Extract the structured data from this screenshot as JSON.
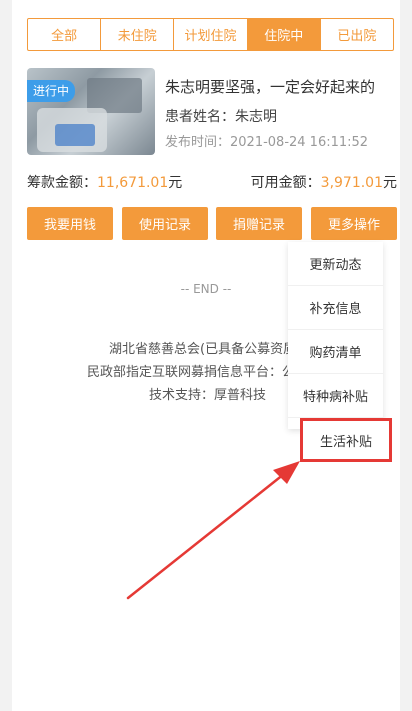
{
  "tabs": [
    {
      "label": "全部",
      "active": false
    },
    {
      "label": "未住院",
      "active": false
    },
    {
      "label": "计划住院",
      "active": false
    },
    {
      "label": "住院中",
      "active": true
    },
    {
      "label": "已出院",
      "active": false
    }
  ],
  "card": {
    "badge": "进行中",
    "title": "朱志明要坚强，一定会好起来的",
    "patient": "患者姓名：朱志明",
    "date": "发布时间：2021-08-24 16:11:52"
  },
  "amounts": {
    "raised_label": "筹款金额：",
    "raised_value": "11,671.01",
    "raised_unit": "元",
    "available_label": "可用金额：",
    "available_value": "3,971.01",
    "available_unit": "元"
  },
  "buttons": [
    "我要用钱",
    "使用记录",
    "捐赠记录",
    "更多操作"
  ],
  "end_text": "-- END --",
  "footer": {
    "line1": "湖北省慈善总会(已具备公募资质",
    "line2": "民政部指定互联网募捐信息平台：公",
    "line3": "技术支持：厚普科技"
  },
  "menu_items": [
    "更新动态",
    "补充信息",
    "购药清单",
    "特种病补贴"
  ],
  "highlighted_item": "生活补贴",
  "colors": {
    "accent": "#f39a3b",
    "badge": "#3d9de9",
    "highlight": "#e53935"
  }
}
